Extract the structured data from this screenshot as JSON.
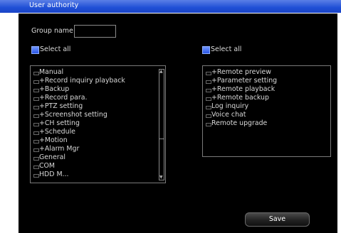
{
  "window": {
    "title": "User authority"
  },
  "group": {
    "label": "Group name",
    "value": ""
  },
  "left_panel": {
    "select_all_label": "Select all",
    "items": [
      {
        "label": "Manual"
      },
      {
        "label": "+Record  inquiry  playback"
      },
      {
        "label": "+Backup"
      },
      {
        "label": "+Record  para."
      },
      {
        "label": "+PTZ  setting"
      },
      {
        "label": "+Screenshot  setting"
      },
      {
        "label": "+CH  setting"
      },
      {
        "label": "+Schedule"
      },
      {
        "label": "+Motion"
      },
      {
        "label": "+Alarm  Mgr"
      },
      {
        "label": "General"
      },
      {
        "label": "COM"
      },
      {
        "label": "HDD  M..."
      }
    ],
    "scroll_position": 0
  },
  "right_panel": {
    "select_all_label": "Select all",
    "items": [
      {
        "label": "+Remote  preview"
      },
      {
        "label": "+Parameter  setting"
      },
      {
        "label": "+Remote  playback"
      },
      {
        "label": "+Remote  backup"
      },
      {
        "label": "Log  inquiry"
      },
      {
        "label": "Voice  chat"
      },
      {
        "label": "Remote  upgrade"
      }
    ]
  },
  "footer": {
    "save_label": "Save"
  }
}
